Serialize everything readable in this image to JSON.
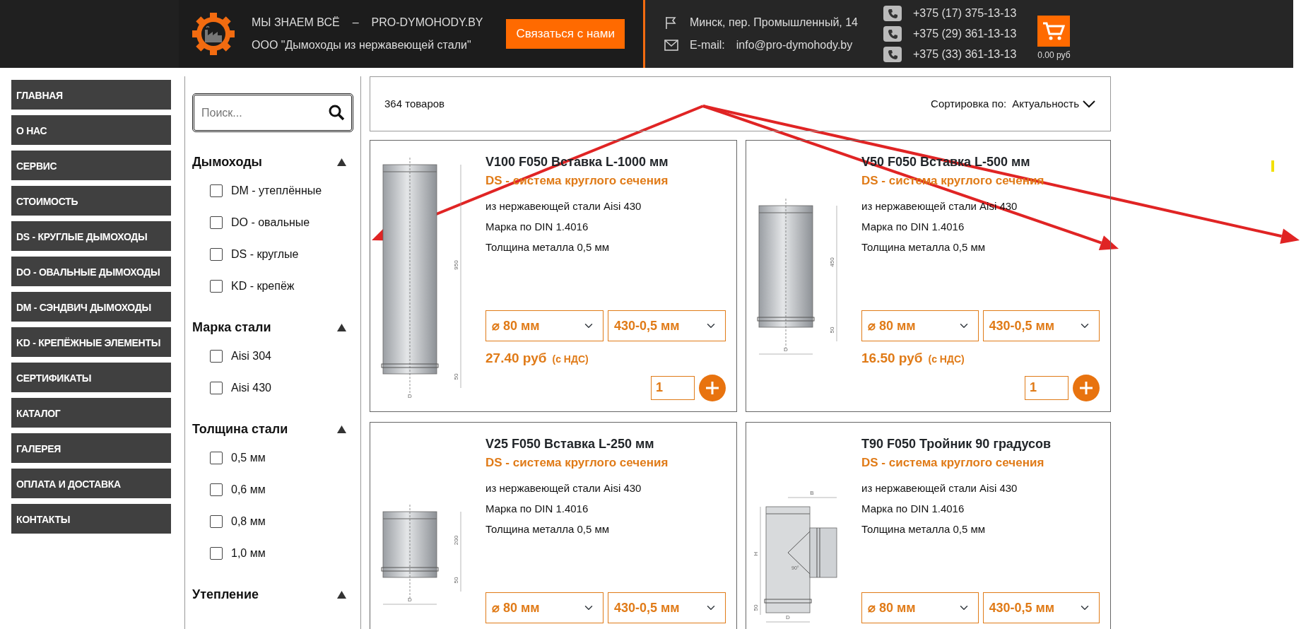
{
  "header": {
    "slogan": "МЫ ЗНАЕМ ВСЁ",
    "dash": "–",
    "site": "PRO-DYMOHODY.BY",
    "company": "ООО \"Дымоходы из нержавеющей стали\"",
    "contact_button": "Связаться с нами",
    "address": "Минск, пер. Промышленный, 14",
    "email_label": "E-mail:",
    "email": "info@pro-dymohody.by",
    "phones": [
      "+375 (17) 375-13-13",
      "+375 (29) 361-13-13",
      "+375 (33) 361-13-13"
    ],
    "cart_total": "0.00 руб"
  },
  "nav": [
    "ГЛАВНАЯ",
    "О НАС",
    "СЕРВИС",
    "СТОИМОСТЬ",
    "DS - КРУГЛЫЕ ДЫМОХОДЫ",
    "DO - ОВАЛЬНЫЕ ДЫМОХОДЫ",
    "DM - СЭНДВИЧ ДЫМОХОДЫ",
    "KD - КРЕПЁЖНЫЕ ЭЛЕМЕНТЫ",
    "СЕРТИФИКАТЫ",
    "КАТАЛОГ",
    "ГАЛЕРЕЯ",
    "ОПЛАТА И ДОСТАВКА",
    "КОНТАКТЫ"
  ],
  "filters": {
    "search": {
      "placeholder": "Поиск..."
    },
    "groups": [
      {
        "title": "Дымоходы",
        "expanded": true,
        "options": [
          {
            "label": "DM - утеплённые",
            "checked": false
          },
          {
            "label": "DO - овальные",
            "checked": false
          },
          {
            "label": "DS - круглые",
            "checked": false
          },
          {
            "label": "KD - крепёж",
            "checked": false
          }
        ]
      },
      {
        "title": "Марка стали",
        "expanded": true,
        "options": [
          {
            "label": "Aisi 304",
            "checked": false
          },
          {
            "label": "Aisi 430",
            "checked": false
          }
        ]
      },
      {
        "title": "Толщина стали",
        "expanded": true,
        "options": [
          {
            "label": "0,5 мм",
            "checked": false
          },
          {
            "label": "0,6 мм",
            "checked": false
          },
          {
            "label": "0,8 мм",
            "checked": false
          },
          {
            "label": "1,0 мм",
            "checked": false
          }
        ]
      },
      {
        "title": "Утепление",
        "expanded": true
      }
    ]
  },
  "catalog": {
    "count": "364 товаров",
    "sort_label": "Сортировка по:",
    "sort_value": "Актуальность",
    "products": [
      {
        "title": "V100 F050 Вставка L-1000 мм",
        "series": "DS - система круглого сечения",
        "details": [
          "из нержавеющей стали Aisi 430",
          "Марка по DIN 1.4016",
          "Толщина металла 0,5 мм"
        ],
        "drawing": {
          "kind": "long",
          "labels": [
            "950",
            "50",
            "D"
          ]
        },
        "diameter": "⌀ 80 мм",
        "steel": "430-0,5 мм",
        "price": "27.40 руб",
        "price_note": "(с НДС)",
        "quantity": "1"
      },
      {
        "title": "V50 F050 Вставка L-500 мм",
        "series": "DS - система круглого сечения",
        "details": [
          "из нержавеющей стали Aisi 430",
          "Марка по DIN 1.4016",
          "Толщина металла 0,5 мм"
        ],
        "drawing": {
          "kind": "medium",
          "labels": [
            "450",
            "50",
            "D"
          ]
        },
        "diameter": "⌀ 80 мм",
        "steel": "430-0,5 мм",
        "price": "16.50 руб",
        "price_note": "(с НДС)",
        "quantity": "1"
      },
      {
        "title": "V25 F050 Вставка L-250 мм",
        "series": "DS - система круглого сечения",
        "details": [
          "из нержавеющей стали Aisi 430",
          "Марка по DIN 1.4016",
          "Толщина металла 0,5 мм"
        ],
        "drawing": {
          "kind": "short",
          "labels": [
            "200",
            "50",
            "D"
          ]
        },
        "diameter": "⌀ 80 мм",
        "steel": "430-0,5 мм"
      },
      {
        "title": "T90 F050 Тройник 90 градусов",
        "series": "DS - система круглого сечения",
        "details": [
          "из нержавеющей стали Aisi 430",
          "Марка по DIN 1.4016",
          "Толщина металла 0,5 мм"
        ],
        "drawing": {
          "kind": "tee",
          "labels": [
            "B",
            "H",
            "90°",
            "50",
            "D"
          ]
        },
        "diameter": "⌀ 80 мм",
        "steel": "430-0,5 мм"
      }
    ]
  }
}
